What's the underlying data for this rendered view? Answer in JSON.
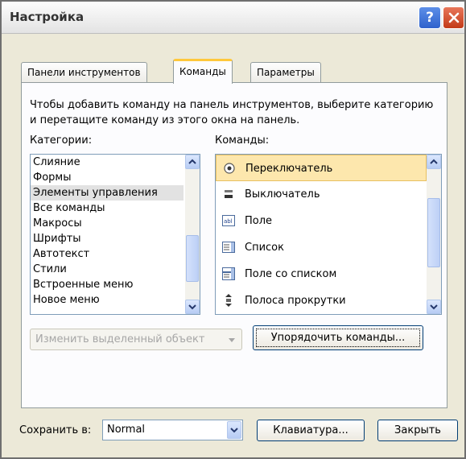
{
  "window": {
    "title": "Настройка",
    "help_label": "?"
  },
  "tabs": [
    {
      "label": "Панели инструментов",
      "active": false
    },
    {
      "label": "Команды",
      "active": true
    },
    {
      "label": "Параметры",
      "active": false
    }
  ],
  "description": "Чтобы добавить команду на панель инструментов, выберите категорию и перетащите команду из этого окна на панель.",
  "categories": {
    "label": "Категории:",
    "items": [
      "Слияние",
      "Формы",
      "Элементы управления",
      "Все команды",
      "Макросы",
      "Шрифты",
      "Автотекст",
      "Стили",
      "Встроенные меню",
      "Новое меню"
    ],
    "selected": "Элементы управления"
  },
  "commands": {
    "label": "Команды:",
    "items": [
      {
        "label": "Переключатель",
        "icon": "radio-button-icon"
      },
      {
        "label": "Выключатель",
        "icon": "toggle-icon"
      },
      {
        "label": "Поле",
        "icon": "text-field-icon"
      },
      {
        "label": "Список",
        "icon": "list-box-icon"
      },
      {
        "label": "Поле со списком",
        "icon": "combo-box-icon"
      },
      {
        "label": "Полоса прокрутки",
        "icon": "scroll-bar-icon"
      }
    ],
    "selected": "Переключатель"
  },
  "buttons": {
    "modify_selection": "Изменить выделенный объект",
    "rearrange": "Упорядочить команды...",
    "keyboard": "Клавиатура...",
    "close": "Закрыть"
  },
  "footer": {
    "save_in_label": "Сохранить в:",
    "save_in_value": "Normal"
  },
  "colors": {
    "accent_tab": "#ffc83c",
    "selected_command_bg": "#fde7ad",
    "close_button": "#c33a18"
  }
}
